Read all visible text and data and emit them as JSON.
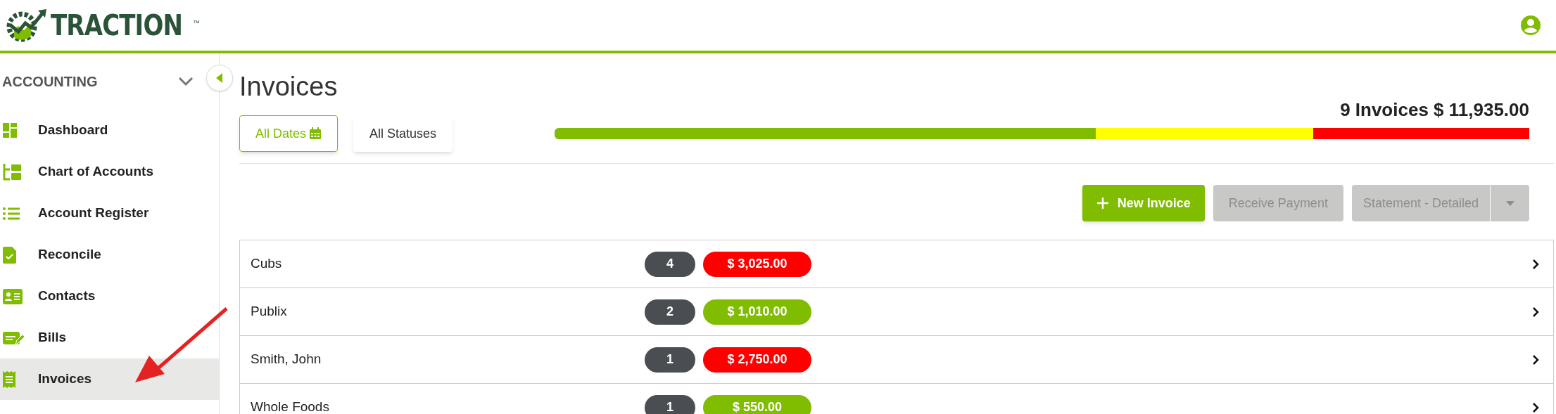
{
  "header": {
    "brand": "TRACTION",
    "trademark": "™"
  },
  "sidebar": {
    "section": "ACCOUNTING",
    "expanded": true,
    "items": [
      {
        "label": "Dashboard",
        "kind": "dashboard",
        "selected": false
      },
      {
        "label": "Chart of Accounts",
        "kind": "chart",
        "selected": false
      },
      {
        "label": "Account Register",
        "kind": "list",
        "selected": false
      },
      {
        "label": "Reconcile",
        "kind": "reconcile",
        "selected": false
      },
      {
        "label": "Contacts",
        "kind": "contacts",
        "selected": false
      },
      {
        "label": "Bills",
        "kind": "bills",
        "selected": false
      },
      {
        "label": "Invoices",
        "kind": "invoices",
        "selected": true
      }
    ]
  },
  "page": {
    "title": "Invoices",
    "filters": [
      {
        "label": "All Dates",
        "selected": true
      },
      {
        "label": "All Statuses",
        "selected": false
      }
    ],
    "summary": "9 Invoices $ 11,935.00",
    "status_bar": [
      {
        "color": "#80bc00"
      },
      {
        "color": "#ffff00"
      },
      {
        "color": "#ff0000"
      }
    ],
    "actions": [
      {
        "label": "New Invoice",
        "kind": "primary",
        "disabled": false
      },
      {
        "label": "Receive Payment",
        "kind": "plain",
        "disabled": true
      },
      {
        "label": "Statement - Detailed",
        "kind": "split",
        "disabled": true
      }
    ],
    "rows": [
      {
        "name": "Cubs",
        "count": "4",
        "amount": "$ 3,025.00",
        "color": "#ff0000"
      },
      {
        "name": "Publix",
        "count": "2",
        "amount": "$ 1,010.00",
        "color": "#80bc00"
      },
      {
        "name": "Smith, John",
        "count": "1",
        "amount": "$ 2,750.00",
        "color": "#ff0000"
      },
      {
        "name": "Whole Foods",
        "count": "1",
        "amount": "$ 550.00",
        "color": "#80bc00"
      }
    ]
  }
}
